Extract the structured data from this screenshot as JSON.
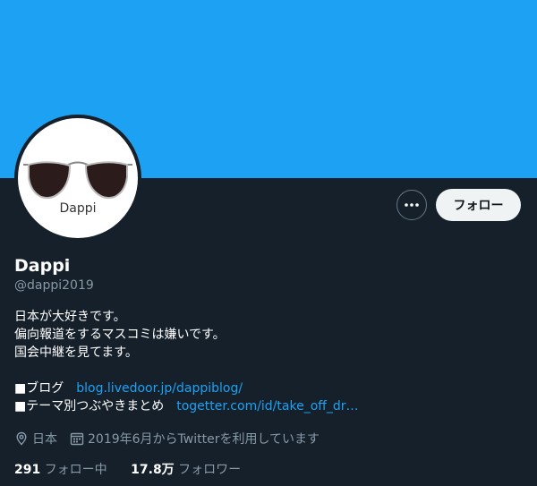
{
  "profile": {
    "avatar_icon": "sunglasses-logo",
    "avatar_label": "Dappi",
    "name": "Dappi",
    "handle": "@dappi2019",
    "bio": [
      "日本が大好きです。",
      "偏向報道をするマスコミは嫌いです。",
      "国会中継を見てます。"
    ],
    "links": [
      {
        "label": "■ブログ",
        "url": "blog.livedoor.jp/dappiblog/"
      },
      {
        "label": "■テーマ別つぶやきまとめ",
        "url": "togetter.com/id/take_off_dr…"
      }
    ],
    "location": "日本",
    "joined": "2019年6月からTwitterを利用しています"
  },
  "actions": {
    "more_icon": "more-dots-icon",
    "follow_label": "フォロー"
  },
  "stats": {
    "following_count": "291",
    "following_label": "フォロー中",
    "followers_count": "17.8万",
    "followers_label": "フォロワー"
  },
  "colors": {
    "banner": "#1da1f2",
    "background": "#15202b",
    "accent": "#1da1f2"
  }
}
